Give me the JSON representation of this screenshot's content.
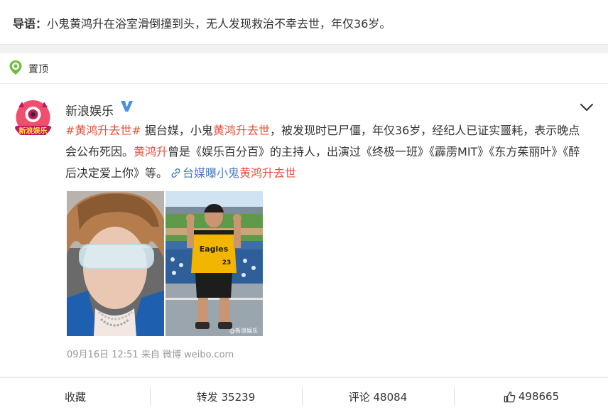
{
  "lead": {
    "label": "导语：",
    "text": "小鬼黄鸿升在浴室滑倒撞到头，无人发现救治不幸去世，年仅36岁。"
  },
  "pinned": {
    "label": "置顶"
  },
  "post": {
    "author": "新浪娱乐",
    "avatar_text": "新浪娱乐",
    "hashtag": "#黄鸿升去世#",
    "t1": " 据台媒，小鬼",
    "h1": "黄鸿升去世",
    "t2": "，被发现时已尸僵，年仅36岁，经纪人已证实噩耗，表示晚点会公布死因。",
    "h2": "黄鸿升",
    "t3": "曾是《娱乐百分百》的主持人，出演过《终极一班》《霹雳MIT》《东方茱丽叶》《醉后决定爱上你》等。",
    "link_prefix": "台媒曝小鬼",
    "link_highlight": "黄鸿升去世",
    "photo_watermark": "@新浪娱乐",
    "jersey_text": "Eagles",
    "jersey_number": "23",
    "meta": "09月16日 12:51  来自 微博 weibo.com"
  },
  "actions": {
    "favorite": "收藏",
    "repost": "转发 35239",
    "comment": "评论 48084",
    "like": "498665"
  },
  "colors": {
    "highlight": "#e8503a",
    "link": "#4a7bbf",
    "verified": "#4a90e2",
    "pin": "#6bbf3b"
  },
  "icons": [
    "pin-icon",
    "verified-icon",
    "chevron-down-icon",
    "link-icon",
    "thumbs-up-icon"
  ]
}
